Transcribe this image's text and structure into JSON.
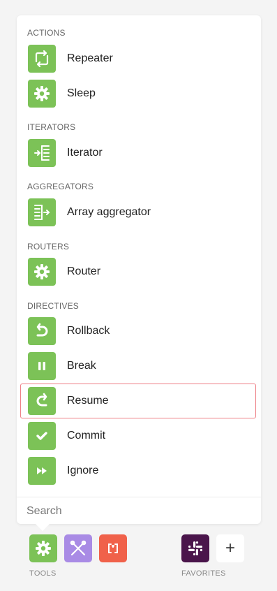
{
  "sections": [
    {
      "header": "ACTIONS",
      "items": [
        {
          "label": "Repeater",
          "icon": "repeater-icon"
        },
        {
          "label": "Sleep",
          "icon": "gear-icon"
        }
      ]
    },
    {
      "header": "ITERATORS",
      "items": [
        {
          "label": "Iterator",
          "icon": "iterator-icon"
        }
      ]
    },
    {
      "header": "AGGREGATORS",
      "items": [
        {
          "label": "Array aggregator",
          "icon": "aggregator-icon"
        }
      ]
    },
    {
      "header": "ROUTERS",
      "items": [
        {
          "label": "Router",
          "icon": "gear-icon"
        }
      ]
    },
    {
      "header": "DIRECTIVES",
      "items": [
        {
          "label": "Rollback",
          "icon": "rollback-icon"
        },
        {
          "label": "Break",
          "icon": "pause-icon"
        },
        {
          "label": "Resume",
          "icon": "resume-icon"
        },
        {
          "label": "Commit",
          "icon": "check-icon"
        },
        {
          "label": "Ignore",
          "icon": "fast-forward-icon"
        }
      ]
    }
  ],
  "search": {
    "placeholder": "Search",
    "value": ""
  },
  "dock": {
    "tools_label": "TOOLS",
    "favorites_label": "FAVORITES",
    "add_symbol": "+"
  },
  "colors": {
    "icon_green": "#7cc257",
    "highlight_border": "#ee7f86",
    "tools_purple": "#a98be5",
    "tools_orange": "#f0614a",
    "slack_purple": "#4a154b"
  }
}
